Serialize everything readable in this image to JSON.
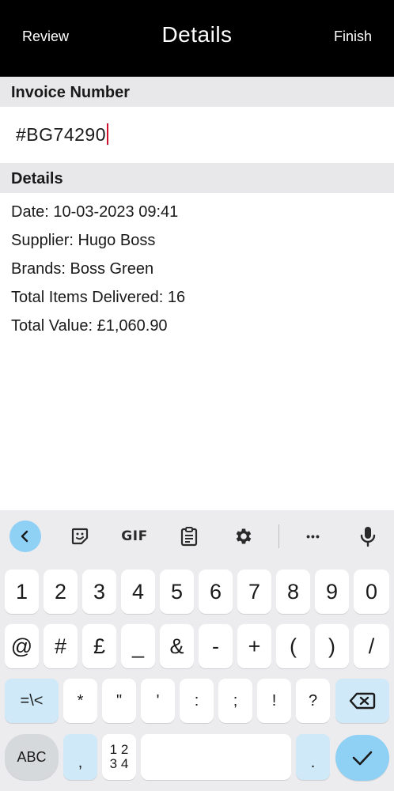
{
  "header": {
    "title": "Details",
    "left_action": "Review",
    "right_action": "Finish"
  },
  "invoice": {
    "section_label": "Invoice Number",
    "value": "#BG74290"
  },
  "details": {
    "section_label": "Details",
    "rows": [
      "Date: 10-03-2023 09:41",
      "Supplier: Hugo Boss",
      "Brands: Boss Green",
      "Total Items Delivered: 16",
      "Total Value: £1,060.90"
    ]
  },
  "keyboard": {
    "toolbar": {
      "gif_label": "GIF",
      "more_label": "•••",
      "icons": [
        "back-chevron-icon",
        "sticker-icon",
        "gif-icon",
        "clipboard-icon",
        "gear-icon",
        "more-icon",
        "microphone-icon"
      ]
    },
    "row1": [
      "1",
      "2",
      "3",
      "4",
      "5",
      "6",
      "7",
      "8",
      "9",
      "0"
    ],
    "row2": [
      "@",
      "#",
      "£",
      "_",
      "&",
      "-",
      "+",
      "(",
      ")",
      "/"
    ],
    "row3": {
      "symbols_toggle": "=\\<",
      "keys": [
        "*",
        "\"",
        "'",
        ":",
        ";",
        "!",
        "?"
      ]
    },
    "row4": {
      "abc": "ABC",
      "comma": ",",
      "numpad_top": "1 2",
      "numpad_bottom": "3 4",
      "period": "."
    },
    "accent_color": "#8fd0f5"
  }
}
